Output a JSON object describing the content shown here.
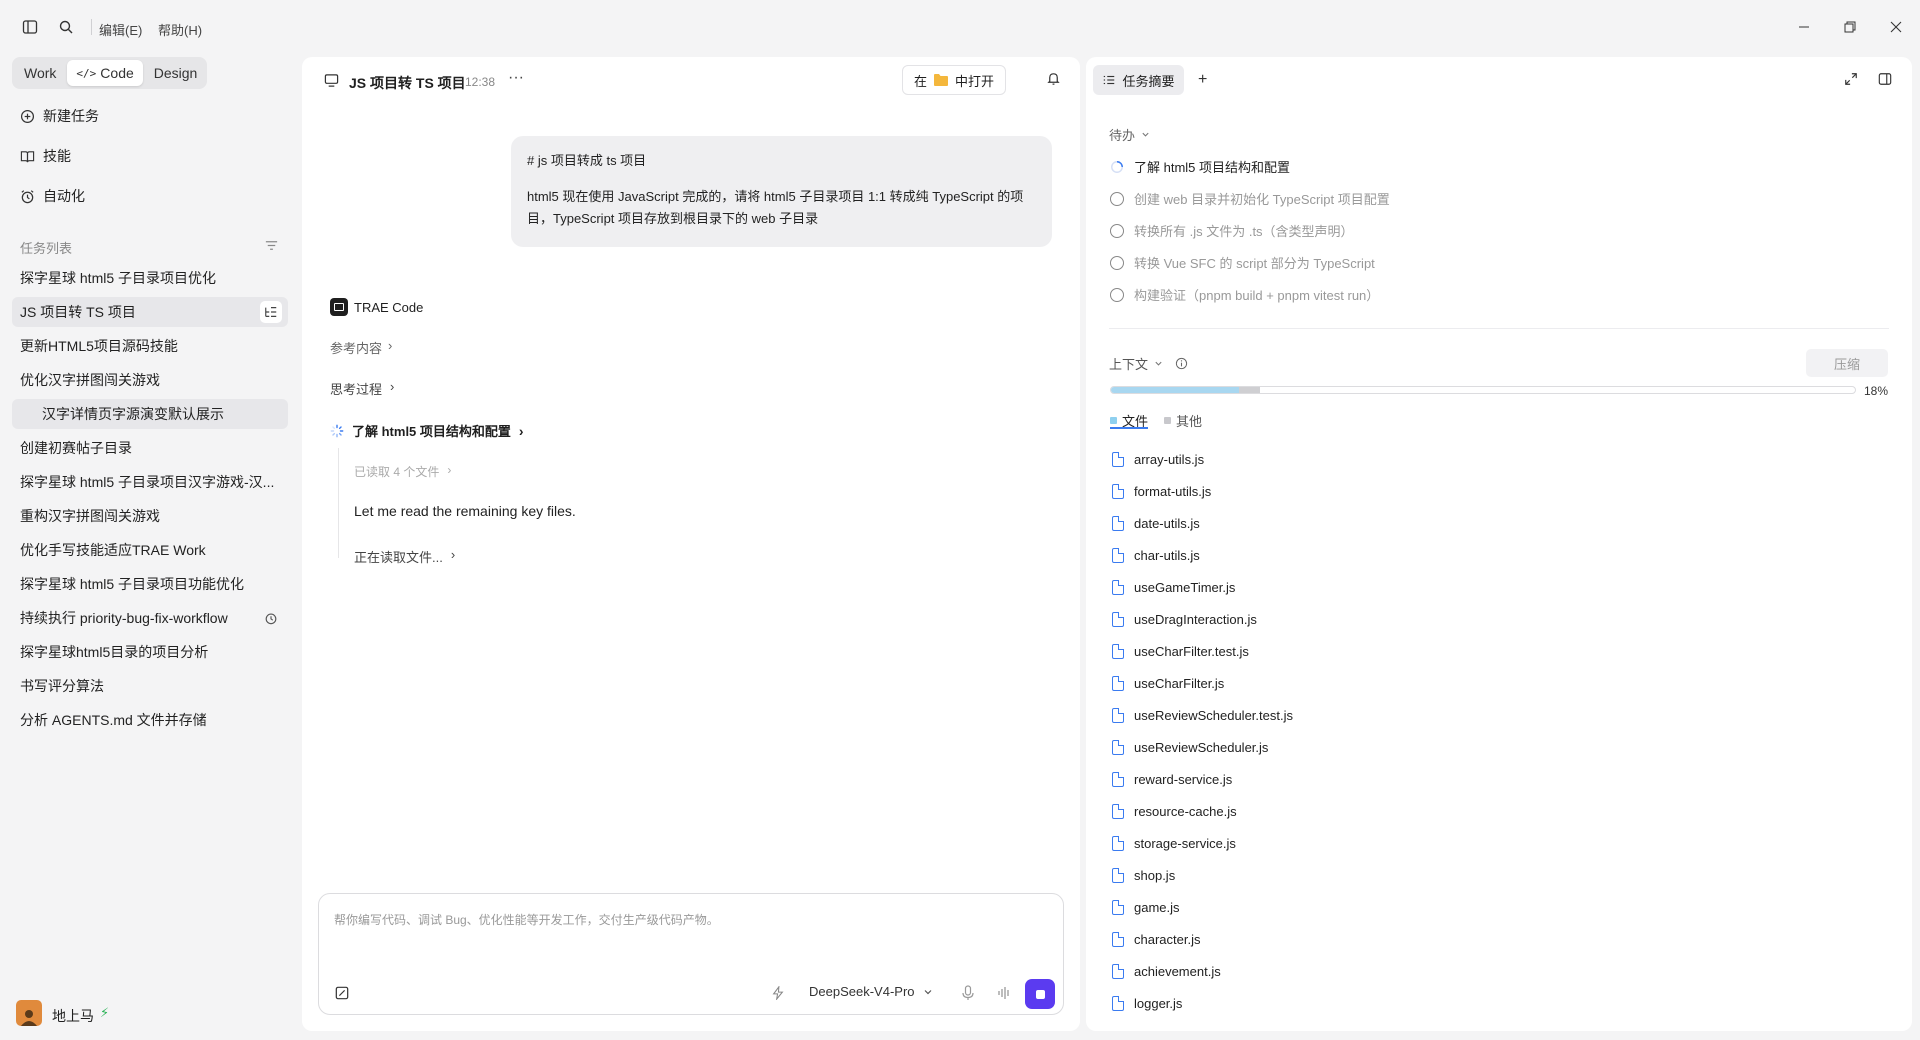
{
  "titlebar": {
    "menus": [
      "编辑(E)",
      "帮助(H)"
    ]
  },
  "modes": [
    {
      "label": "Work",
      "active": false
    },
    {
      "label": "Code",
      "active": true
    },
    {
      "label": "Design",
      "active": false
    }
  ],
  "sidebar": {
    "new_task": "新建任务",
    "skills": "技能",
    "automation": "自动化",
    "task_list_label": "任务列表",
    "tasks": [
      "探字星球 html5 子目录项目优化",
      "JS 项目转 TS 项目",
      "更新HTML5项目源码技能",
      "优化汉字拼图闯关游戏",
      "汉字详情页字源演变默认展示",
      "创建初赛帖子目录",
      "探字星球 html5 子目录项目汉字游戏-汉...",
      "重构汉字拼图闯关游戏",
      "优化手写技能适应TRAE Work",
      "探字星球 html5 子目录项目功能优化",
      "持续执行 priority-bug-fix-workflow",
      "探字星球html5目录的项目分析",
      "书写评分算法",
      "分析 AGENTS.md 文件并存储"
    ],
    "user_name": "地上马"
  },
  "chat": {
    "title": "JS 项目转 TS 项目",
    "time": "12:38",
    "more": "···",
    "open_in_prefix": "在",
    "open_in_suffix": "中打开",
    "user_message": {
      "line1": "# js 项目转成 ts 项目",
      "line2": "html5 现在使用 JavaScript 完成的，请将 html5 子目录项目 1:1 转成纯 TypeScript 的项目，TypeScript 项目存放到根目录下的 web 子目录"
    },
    "assistant_name": "TRAE Code",
    "references": "参考内容",
    "thinking": "思考过程",
    "step_title": "了解 html5 项目结构和配置",
    "files_read": "已读取 4 个文件",
    "reply_text": "Let me read the remaining key files.",
    "reading": "正在读取文件...",
    "input_placeholder": "帮你编写代码、调试 Bug、优化性能等开发工作，交付生产级代码产物。",
    "model": "DeepSeek-V4-Pro"
  },
  "right": {
    "tab_label": "任务摘要",
    "todo_label": "待办",
    "todos": [
      {
        "text": "了解 html5 项目结构和配置",
        "status": "in_progress"
      },
      {
        "text": "创建 web 目录并初始化 TypeScript 项目配置",
        "status": "pending"
      },
      {
        "text": "转换所有 .js 文件为 .ts（含类型声明）",
        "status": "pending"
      },
      {
        "text": "转换 Vue SFC 的 script 部分为 TypeScript",
        "status": "pending"
      },
      {
        "text": "构建验证（pnpm build + pnpm vitest run）",
        "status": "pending"
      }
    ],
    "context_label": "上下文",
    "compress_button": "压缩",
    "context_percent": "18%",
    "context_fill_fraction": 0.2,
    "file_tab": "文件",
    "other_tab": "其他",
    "files": [
      "array-utils.js",
      "format-utils.js",
      "date-utils.js",
      "char-utils.js",
      "useGameTimer.js",
      "useDragInteraction.js",
      "useCharFilter.test.js",
      "useCharFilter.js",
      "useReviewScheduler.test.js",
      "useReviewScheduler.js",
      "reward-service.js",
      "resource-cache.js",
      "storage-service.js",
      "shop.js",
      "game.js",
      "character.js",
      "achievement.js",
      "logger.js"
    ]
  }
}
